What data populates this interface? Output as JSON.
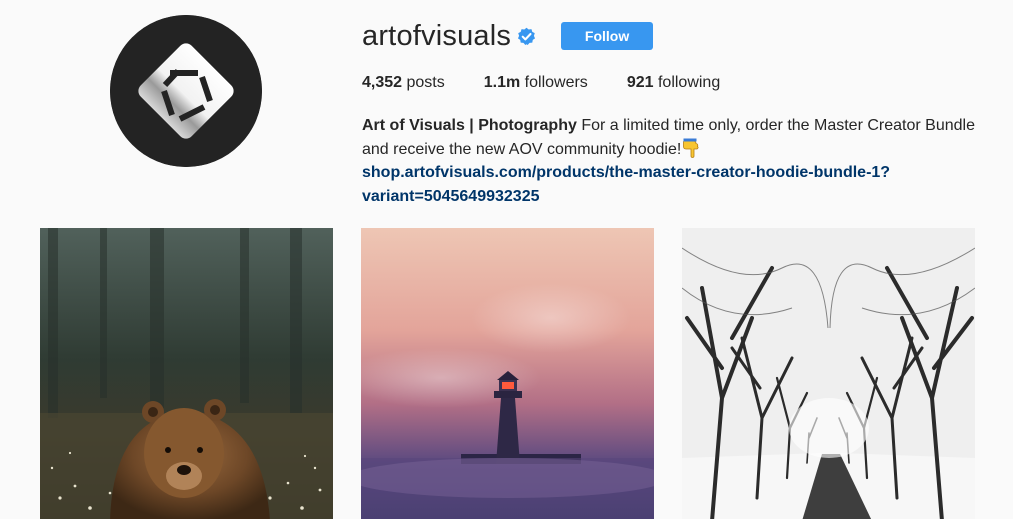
{
  "profile": {
    "username": "artofvisuals",
    "verified_icon": "verified-badge-icon",
    "follow_label": "Follow",
    "stats": {
      "posts_count": "4,352",
      "posts_label": "posts",
      "followers_count": "1.1m",
      "followers_label": "followers",
      "following_count": "921",
      "following_label": "following"
    },
    "bio": {
      "full_name": "Art of Visuals | Photography",
      "text": " For a limited time only, order the Master Creator Bundle and receive the new AOV community hoodie!",
      "emoji_icon": "backhand-index-pointing-down-icon",
      "link": "shop.artofvisuals.com/products/the-master-creator-hoodie-bundle-1?variant=5045649932325"
    }
  },
  "colors": {
    "follow_button": "#3897f0",
    "link": "#003569",
    "verified": "#3897f0",
    "background": "#fafafa"
  },
  "posts": [
    {
      "subject": "brown bear in misty forest meadow"
    },
    {
      "subject": "lighthouse in pink sunrise fog"
    },
    {
      "subject": "snowy tree-lined road"
    }
  ]
}
